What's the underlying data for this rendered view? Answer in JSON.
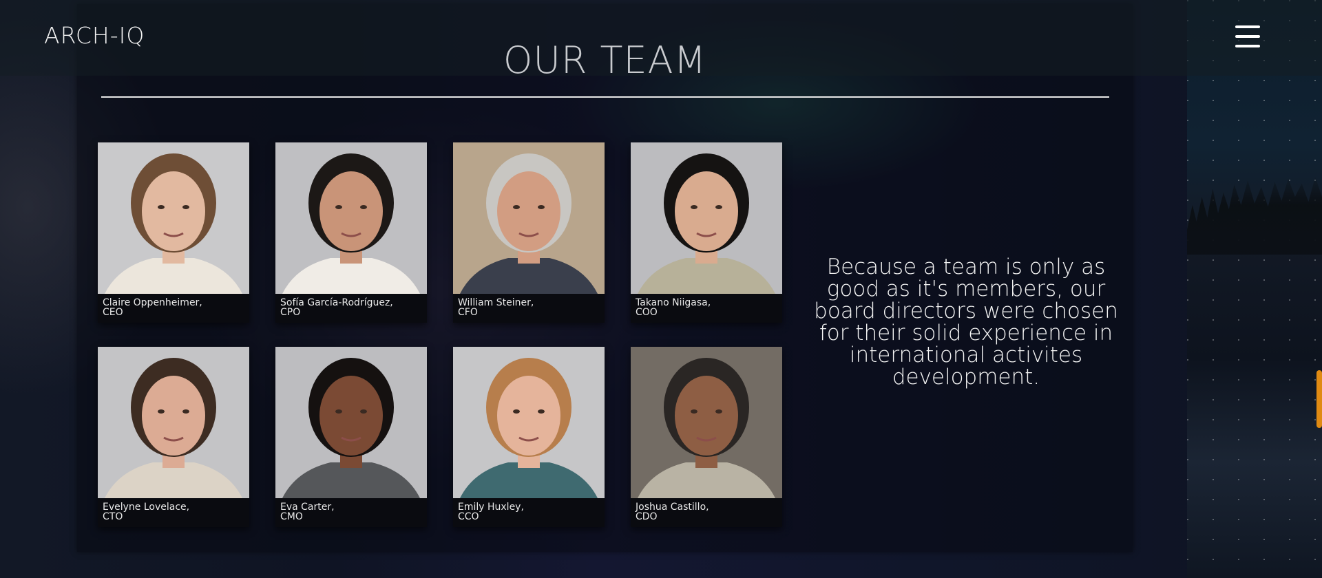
{
  "header": {
    "logo": "ARCH-IQ",
    "menu_icon": "hamburger-menu-icon"
  },
  "section": {
    "title": "OUR TEAM",
    "tagline": "Because a team is only as good as it's members, our board directors were chosen for their solid experience in international activites development."
  },
  "team": [
    {
      "name": "Claire Oppenheimer,",
      "role": "CEO",
      "colors": {
        "bg": "#c9c9cb",
        "skin": "#e2b9a0",
        "hair": "#6e4e36",
        "shirt": "#ece6dc"
      }
    },
    {
      "name": "Sofía García-Rodríguez,",
      "role": "CPO",
      "colors": {
        "bg": "#bfbfc2",
        "skin": "#c99478",
        "hair": "#1c1816",
        "shirt": "#f0ece6"
      }
    },
    {
      "name": "William Steiner,",
      "role": "CFO",
      "colors": {
        "bg": "#b8a58c",
        "skin": "#d29d82",
        "hair": "#c8c6c2",
        "shirt": "#3a3f4c"
      }
    },
    {
      "name": "Takano Niigasa,",
      "role": "COO",
      "colors": {
        "bg": "#bcbcbf",
        "skin": "#d9ab8f",
        "hair": "#151312",
        "shirt": "#b7b199"
      }
    },
    {
      "name": "Evelyne Lovelace,",
      "role": "CTO",
      "colors": {
        "bg": "#c4c4c6",
        "skin": "#dcab94",
        "hair": "#3d2c22",
        "shirt": "#dcd3c6"
      }
    },
    {
      "name": "Eva Carter,",
      "role": "CMO",
      "colors": {
        "bg": "#bdbdc0",
        "skin": "#7b4a34",
        "hair": "#151110",
        "shirt": "#55575a"
      }
    },
    {
      "name": "Emily Huxley,",
      "role": "CCO",
      "colors": {
        "bg": "#c6c6c8",
        "skin": "#e5b49b",
        "hair": "#b77e4c",
        "shirt": "#3f6a70"
      }
    },
    {
      "name": "Joshua Castillo,",
      "role": "CDO",
      "colors": {
        "bg": "#736c64",
        "skin": "#8e5e44",
        "hair": "#2a2624",
        "shirt": "#b9b3a4"
      }
    }
  ],
  "scrollbar": {
    "color": "#e08a12"
  }
}
